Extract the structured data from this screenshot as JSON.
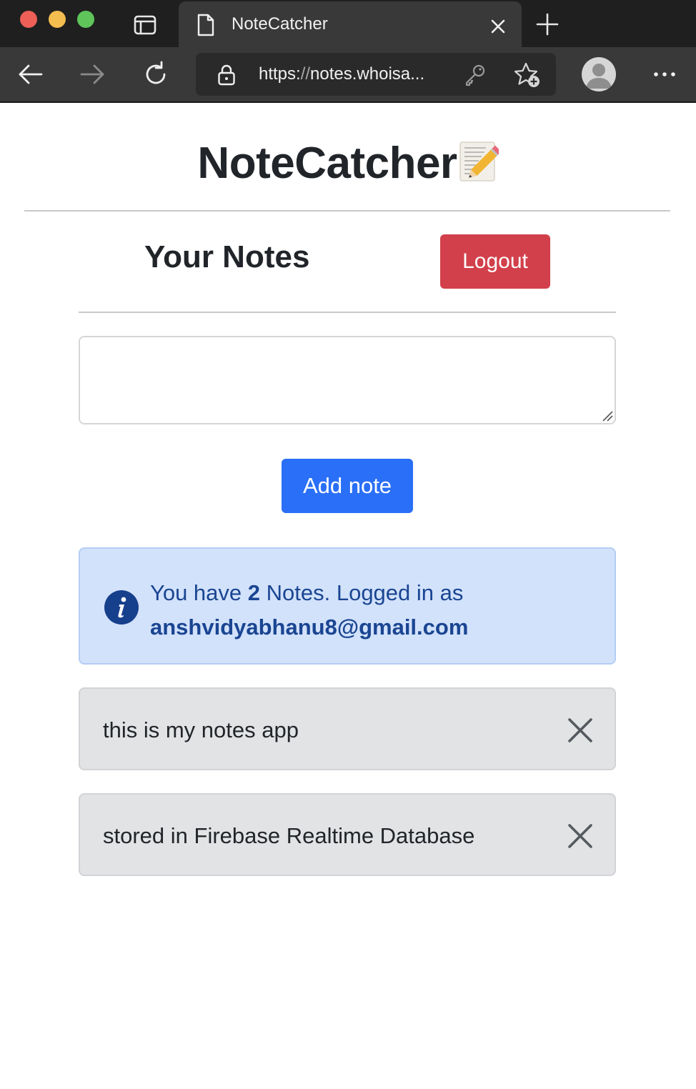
{
  "browser": {
    "tab_title": "NoteCatcher",
    "url_scheme": "https:",
    "url_sep": "//",
    "url_rest": "notes.whoisa..."
  },
  "app": {
    "title": "NoteCatcher",
    "title_emoji": "memo-icon"
  },
  "header": {
    "heading": "Your Notes",
    "logout_label": "Logout"
  },
  "composer": {
    "placeholder": "",
    "value": "",
    "add_label": "Add note"
  },
  "info": {
    "prefix": "You have ",
    "count": "2",
    "middle": " Notes. Logged in as",
    "email": "anshvidyabhanu8@gmail.com"
  },
  "notes": [
    {
      "text": "this is my notes app"
    },
    {
      "text": "stored in Firebase Realtime Database"
    }
  ],
  "colors": {
    "logout": "#d2404b",
    "add": "#2a6ff7",
    "alert_bg": "#d2e2fb",
    "alert_text": "#1a4592",
    "note_bg": "#e2e3e5"
  }
}
